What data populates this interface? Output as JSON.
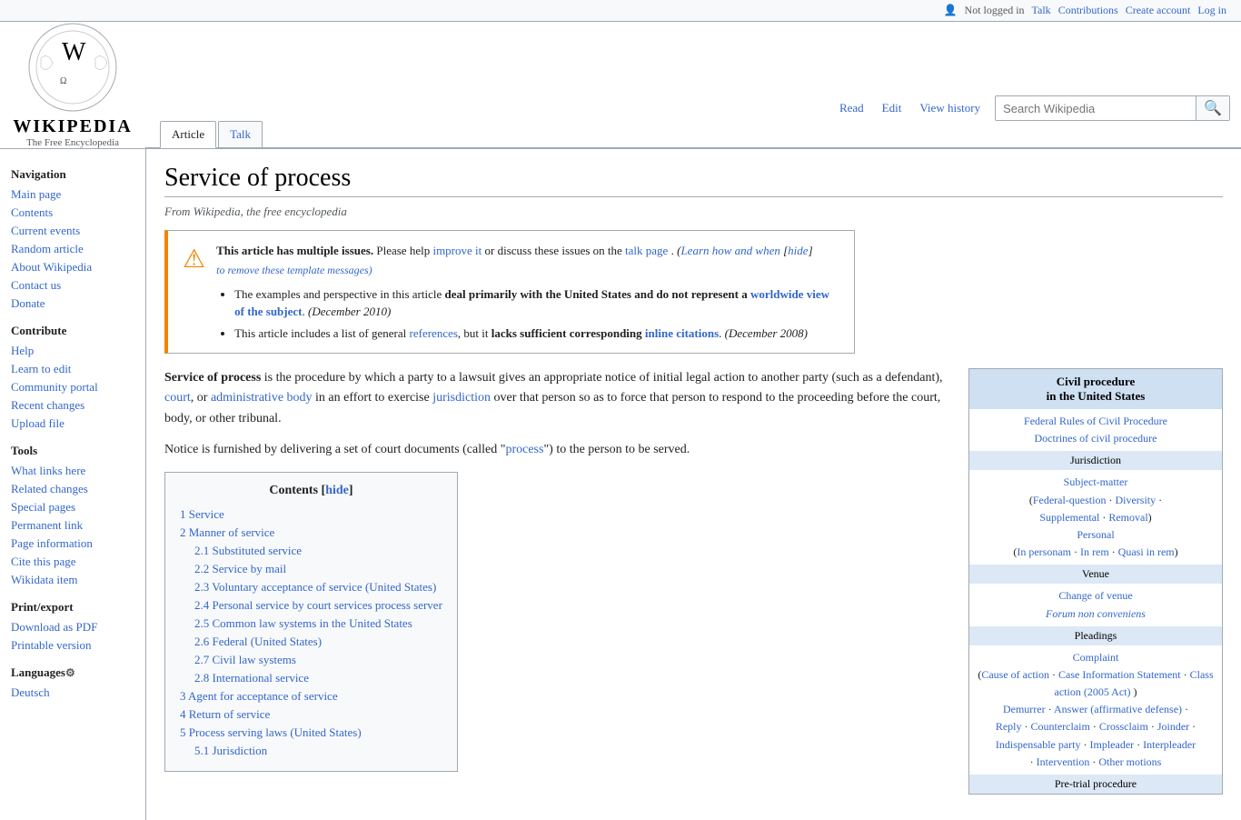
{
  "topbar": {
    "not_logged_in": "Not logged in",
    "talk": "Talk",
    "contributions": "Contributions",
    "create_account": "Create account",
    "log_in": "Log in"
  },
  "logo": {
    "title": "Wikipedia",
    "subtitle": "The Free Encyclopedia"
  },
  "tabs": {
    "article": "Article",
    "talk": "Talk",
    "read": "Read",
    "edit": "Edit",
    "view_history": "View history"
  },
  "search": {
    "placeholder": "Search Wikipedia"
  },
  "sidebar": {
    "navigation_header": "Navigation",
    "main_page": "Main page",
    "contents": "Contents",
    "current_events": "Current events",
    "random_article": "Random article",
    "about_wikipedia": "About Wikipedia",
    "contact_us": "Contact us",
    "donate": "Donate",
    "contribute_header": "Contribute",
    "help": "Help",
    "learn_to_edit": "Learn to edit",
    "community_portal": "Community portal",
    "recent_changes": "Recent changes",
    "upload_file": "Upload file",
    "tools_header": "Tools",
    "what_links_here": "What links here",
    "related_changes": "Related changes",
    "special_pages": "Special pages",
    "permanent_link": "Permanent link",
    "page_information": "Page information",
    "cite_this_page": "Cite this page",
    "wikidata_item": "Wikidata item",
    "print_header": "Print/export",
    "download_pdf": "Download as PDF",
    "printable_version": "Printable version",
    "languages_header": "Languages",
    "deutsch": "Deutsch"
  },
  "page": {
    "title": "Service of process",
    "subtitle": "From Wikipedia, the free encyclopedia"
  },
  "warning": {
    "bold_text": "This article has multiple issues.",
    "text1": " Please help ",
    "improve_it": "improve it",
    "text2": " or discuss these issues on the ",
    "talk_page": "talk page",
    "text3": ". ",
    "learn": "(Learn how and when",
    "hide": "hide",
    "remove_text": "to remove these template messages)",
    "bullet1_pre": "The examples and perspective in this article ",
    "bullet1_bold": "deal primarily with the United States and do not represent a ",
    "bullet1_link": "worldwide view of the subject",
    "bullet1_date": ". (December 2010)",
    "bullet2_pre": "This article includes a list of general ",
    "bullet2_link": "references",
    "bullet2_mid": ", but it ",
    "bullet2_bold": "lacks sufficient corresponding ",
    "bullet2_link2": "inline citations",
    "bullet2_date": ". (December 2008)"
  },
  "intro": {
    "bold": "Service of process",
    "text": " is the procedure by which a party to a lawsuit gives an appropriate notice of initial legal action to another party (such as a defendant), ",
    "court": "court",
    "text2": ", or ",
    "admin_body": "administrative body",
    "text3": " in an effort to exercise ",
    "jurisdiction": "jurisdiction",
    "text4": " over that person so as to force that person to respond to the proceeding before the court, body, or other tribunal.",
    "notice_text": "Notice is furnished by delivering a set of court documents (called \"",
    "process": "process",
    "notice_end": "\") to the person to be served."
  },
  "toc": {
    "title": "Contents",
    "hide": "hide",
    "items": [
      {
        "num": "1",
        "label": "Service"
      },
      {
        "num": "2",
        "label": "Manner of service"
      },
      {
        "num": "2.1",
        "label": "Substituted service",
        "sub": true
      },
      {
        "num": "2.2",
        "label": "Service by mail",
        "sub": true
      },
      {
        "num": "2.3",
        "label": "Voluntary acceptance of service (United States)",
        "sub": true
      },
      {
        "num": "2.4",
        "label": "Personal service by court services process server",
        "sub": true
      },
      {
        "num": "2.5",
        "label": "Common law systems in the United States",
        "sub": true
      },
      {
        "num": "2.6",
        "label": "Federal (United States)",
        "sub": true
      },
      {
        "num": "2.7",
        "label": "Civil law systems",
        "sub": true
      },
      {
        "num": "2.8",
        "label": "International service",
        "sub": true
      },
      {
        "num": "3",
        "label": "Agent for acceptance of service"
      },
      {
        "num": "4",
        "label": "Return of service"
      },
      {
        "num": "5",
        "label": "Process serving laws (United States)"
      },
      {
        "num": "5.1",
        "label": "Jurisdiction",
        "sub": true
      }
    ]
  },
  "civil_box": {
    "title_line1": "Civil procedure",
    "title_line2": "in the United States",
    "link1": "Federal Rules of Civil Procedure",
    "link2": "Doctrines of civil procedure",
    "sections": [
      {
        "header": "Jurisdiction",
        "items": [
          "Subject-matter",
          "(Federal-question · Diversity · Supplemental · Removal)",
          "Personal",
          "(In personam · In rem · Quasi in rem)"
        ]
      },
      {
        "header": "Venue",
        "items": [
          "Change of venue",
          "Forum non conveniens"
        ]
      },
      {
        "header": "Pleadings",
        "items": [
          "Complaint",
          "(Cause of action · Case Information Statement · Class action (2005 Act) )",
          "Demurrer · Answer (affirmative defense) ·",
          "Reply · Counterclaim · Crossclaim · Joinder ·",
          "Indispensable party · Impleader · Interpleader",
          "· Intervention · Other motions"
        ]
      },
      {
        "header": "Pre-trial procedure"
      }
    ]
  }
}
